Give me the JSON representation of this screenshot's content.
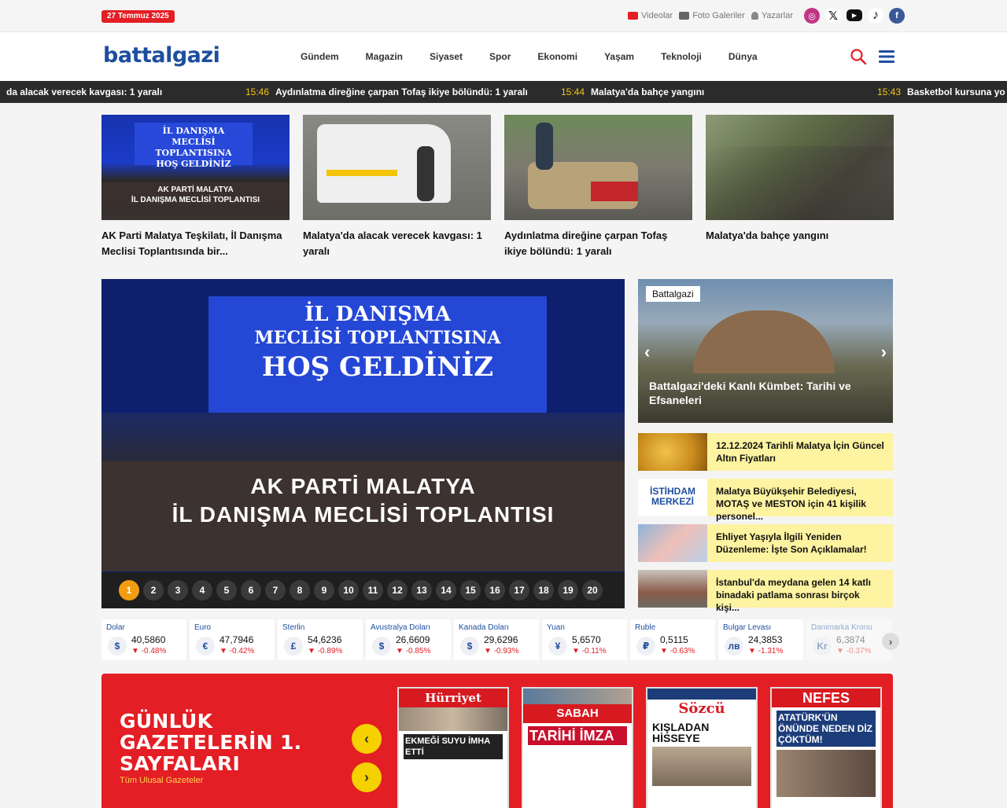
{
  "topbar": {
    "date": "27 Temmuz 2025",
    "links": [
      {
        "label": "Videolar",
        "icon": "video-icon"
      },
      {
        "label": "Foto Galeriler",
        "icon": "photo-gallery-icon"
      },
      {
        "label": "Yazarlar",
        "icon": "writers-icon"
      }
    ],
    "social": [
      "instagram-icon",
      "x-icon",
      "youtube-icon",
      "tiktok-icon",
      "facebook-icon"
    ]
  },
  "header": {
    "logo": "battalgazi",
    "nav": [
      "Gündem",
      "Magazin",
      "Siyaset",
      "Spor",
      "Ekonomi",
      "Yaşam",
      "Teknoloji",
      "Dünya"
    ]
  },
  "ticker": [
    {
      "time": "",
      "text": "da alacak verecek kavgası: 1 yaralı"
    },
    {
      "time": "15:46",
      "text": "Aydınlatma direğine çarpan Tofaş ikiye bölündü: 1 yaralı"
    },
    {
      "time": "15:44",
      "text": "Malatya'da bahçe yangını"
    },
    {
      "time": "15:43",
      "text": "Basketbol kursuna yo"
    }
  ],
  "top_cards": [
    {
      "title": "AK Parti Malatya Teşkilatı, İl Danışma Meclisi Toplantısında bir..."
    },
    {
      "title": "Malatya'da alacak verecek kavgası: 1 yaralı"
    },
    {
      "title": "Aydınlatma direğine çarpan Tofaş ikiye bölündü: 1 yaralı"
    },
    {
      "title": "Malatya'da bahçe yangını"
    }
  ],
  "main_slider": {
    "banner_lines": [
      "İL DANIŞMA",
      "MECLİSİ TOPLANTISINA",
      "HOŞ GELDİNİZ"
    ],
    "lower_lines": [
      "AK PARTİ  MALATYA",
      "İL DANIŞMA MECLİSİ TOPLANTISI"
    ],
    "pages": [
      "1",
      "2",
      "3",
      "4",
      "5",
      "6",
      "7",
      "8",
      "9",
      "10",
      "11",
      "12",
      "13",
      "14",
      "15",
      "16",
      "17",
      "18",
      "19",
      "20"
    ],
    "active_page": "1"
  },
  "side_slider": {
    "badge": "Battalgazi",
    "title": "Battalgazi'deki Kanlı Kümbet: Tarihi ve Efsaneleri"
  },
  "mini_news": [
    {
      "title": "12.12.2024 Tarihli Malatya İçin Güncel Altın Fiyatları"
    },
    {
      "title": "Malatya Büyükşehir Belediyesi, MOTAŞ ve MESTON için 41 kişilik personel..."
    },
    {
      "title": "Ehliyet Yaşıyla İlgili Yeniden Düzenleme: İşte Son Açıklamalar!"
    },
    {
      "title": "İstanbul'da meydana gelen 14 katlı binadaki patlama sonrası birçok kişi..."
    }
  ],
  "currencies": [
    {
      "name": "Dolar",
      "symbol": "$",
      "value": "40,5860",
      "change": "-0.48%"
    },
    {
      "name": "Euro",
      "symbol": "€",
      "value": "47,7946",
      "change": "-0.42%"
    },
    {
      "name": "Sterlin",
      "symbol": "£",
      "value": "54,6236",
      "change": "-0.89%"
    },
    {
      "name": "Avustralya Doları",
      "symbol": "$",
      "value": "26,6609",
      "change": "-0.85%"
    },
    {
      "name": "Kanada Doları",
      "symbol": "$",
      "value": "29,6296",
      "change": "-0.93%"
    },
    {
      "name": "Yuan",
      "symbol": "¥",
      "value": "5,6570",
      "change": "-0.11%"
    },
    {
      "name": "Ruble",
      "symbol": "₽",
      "value": "0,5115",
      "change": "-0.63%"
    },
    {
      "name": "Bulgar Levası",
      "symbol": "лв",
      "value": "24,3853",
      "change": "-1.31%"
    },
    {
      "name": "Danimarka Kronu",
      "symbol": "Kr",
      "value": "6,3874",
      "change": "-0.37%"
    }
  ],
  "newspapers": {
    "title_lines": [
      "GÜNLÜK",
      "GAZETELERİN 1.",
      "SAYFALARI"
    ],
    "subtitle": "Tüm Ulusal Gazeteler",
    "items": [
      {
        "masthead": "Hürriyet",
        "headline": "EKMEĞİ SUYU İMHA ETTİ"
      },
      {
        "masthead": "SABAH",
        "headline": "TARİHİ İMZA"
      },
      {
        "masthead": "Sözcü",
        "headline": "KIŞLADAN HİSSEYE"
      },
      {
        "masthead": "NEFES",
        "headline": "ATATÜRK'ÜN ÖNÜNDE NEDEN DİZ ÇÖKTÜM!"
      }
    ]
  }
}
